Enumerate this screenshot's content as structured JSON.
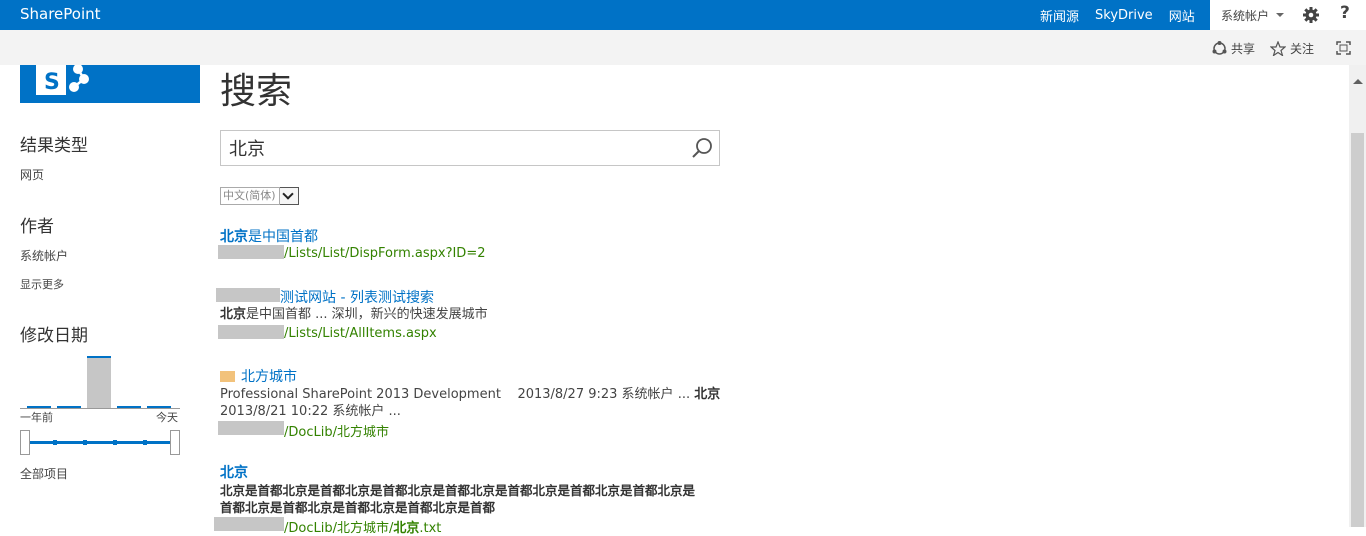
{
  "suitebar": {
    "brand": "SharePoint",
    "nav": [
      "新闻源",
      "SkyDrive",
      "网站"
    ],
    "account": "系统帐户",
    "help": "?"
  },
  "ribbon": {
    "share": "共享",
    "follow": "关注"
  },
  "page": {
    "title": "搜索"
  },
  "search": {
    "query": "北京",
    "language": "中文(简体)"
  },
  "refiners": {
    "result_type": {
      "title": "结果类型",
      "items": [
        "网页"
      ]
    },
    "author": {
      "title": "作者",
      "items": [
        "系统帐户"
      ],
      "more": "显示更多"
    },
    "modified": {
      "title": "修改日期",
      "range_start": "一年前",
      "range_end": "今天",
      "all_items": "全部项目",
      "histogram": [
        0.04,
        0.04,
        1.0,
        0.04,
        0.04
      ]
    }
  },
  "results": [
    {
      "title_bold": "北京",
      "title_rest": "是中国首都",
      "url": "/Lists/List/DispForm.aspx?ID=2"
    },
    {
      "title": "测试网站 - 列表测试搜索",
      "desc_bold": "北京",
      "desc_rest": "是中国首都 ... 深圳，新兴的快速发展城市",
      "url": "/Lists/List/AllItems.aspx"
    },
    {
      "title": "北方城市",
      "line1_pre": "Professional SharePoint 2013 Development    2013/8/27 9:23 系统帐户 ... ",
      "line1_bold": "北京",
      "line2": "2013/8/21 10:22 系统帐户 ...",
      "url": "/DocLib/北方城市"
    },
    {
      "title": "北京",
      "desc_line1": "北京是首都北京是首都北京是首都北京是首都北京是首都北京是首都北京是首都北京是",
      "desc_line2": "首都北京是首都北京是首都北京是首都北京是首都",
      "url_pre": "/DocLib/北方城市/",
      "url_bold": "北京",
      "url_post": ".txt"
    }
  ]
}
